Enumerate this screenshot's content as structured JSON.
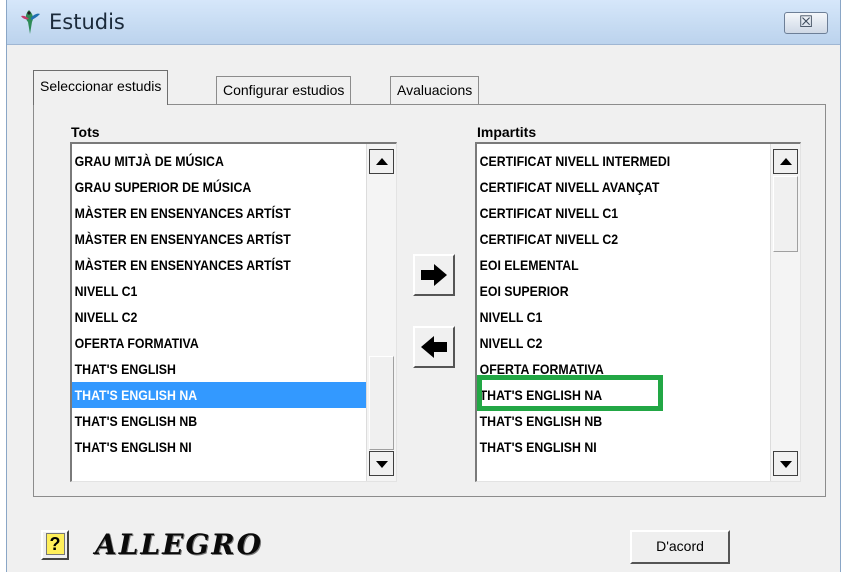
{
  "window": {
    "title": "Estudis",
    "close_symbol": "☒"
  },
  "tabs": [
    {
      "label": "Seleccionar estudis",
      "active": true
    },
    {
      "label": "Configurar estudios",
      "active": false
    },
    {
      "label": "Avaluacions",
      "active": false
    }
  ],
  "left_list": {
    "caption": "Tots",
    "items": [
      "GRAU MITJÀ DE MÚSICA",
      "GRAU SUPERIOR DE MÚSICA",
      "MÀSTER EN ENSENYANCES ARTÍST",
      "MÀSTER EN ENSENYANCES ARTÍST",
      "MÀSTER EN ENSENYANCES ARTÍST",
      "NIVELL C1",
      "NIVELL C2",
      "OFERTA FORMATIVA",
      "THAT'S ENGLISH",
      "THAT'S ENGLISH NA",
      "THAT'S ENGLISH NB",
      "THAT'S ENGLISH NI"
    ],
    "selected_index": 9
  },
  "right_list": {
    "caption": "Impartits",
    "items": [
      "CERTIFICAT NIVELL  INTERMEDI",
      "CERTIFICAT NIVELL AVANÇAT",
      "CERTIFICAT NIVELL C1",
      "CERTIFICAT NIVELL C2",
      "EOI ELEMENTAL",
      "EOI SUPERIOR",
      "NIVELL C1",
      "NIVELL C2",
      "OFERTA FORMATIVA",
      "THAT'S ENGLISH NA",
      "THAT'S ENGLISH NB",
      "THAT'S ENGLISH NI"
    ]
  },
  "icons": {
    "add": "arrow-right-icon",
    "remove": "arrow-left-icon",
    "help": "question-icon",
    "app": "hummingbird-icon"
  },
  "footer": {
    "help_label": "?",
    "logo_text": "ALLEGRO",
    "ok_label": "D'acord"
  },
  "colors": {
    "selection": "#3399ff",
    "highlight_box": "#22a745"
  }
}
